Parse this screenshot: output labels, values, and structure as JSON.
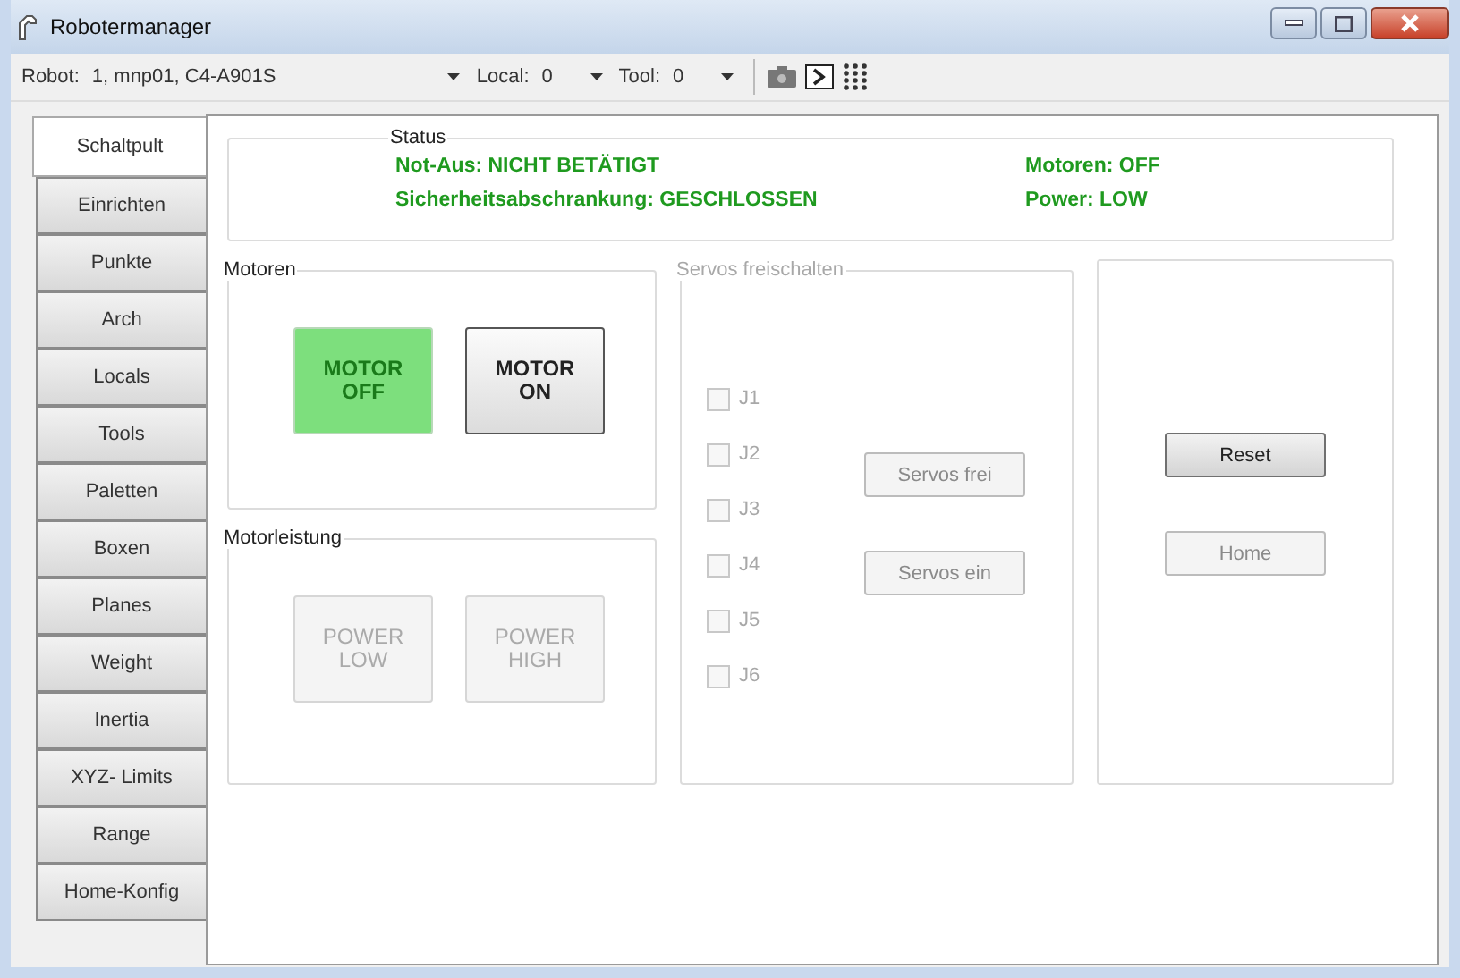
{
  "window": {
    "title": "Robotermanager"
  },
  "toolbar": {
    "fields": [
      {
        "label": "Robot:",
        "value": "1, mnp01, C4-A901S",
        "kind": "wide"
      },
      {
        "label": "Local:",
        "value": "0",
        "kind": "narrow"
      },
      {
        "label": "Tool:",
        "value": "0",
        "kind": "narrow"
      }
    ]
  },
  "tabs": [
    {
      "label": "Schaltpult",
      "selected": true
    },
    {
      "label": "Einrichten",
      "selected": false
    },
    {
      "label": "Punkte",
      "selected": false
    },
    {
      "label": "Arch",
      "selected": false
    },
    {
      "label": "Locals",
      "selected": false
    },
    {
      "label": "Tools",
      "selected": false
    },
    {
      "label": "Paletten",
      "selected": false
    },
    {
      "label": "Boxen",
      "selected": false
    },
    {
      "label": "Planes",
      "selected": false
    },
    {
      "label": "Weight",
      "selected": false
    },
    {
      "label": "Inertia",
      "selected": false
    },
    {
      "label": "XYZ- Limits",
      "selected": false
    },
    {
      "label": "Range",
      "selected": false
    },
    {
      "label": "Home-Konfig",
      "selected": false
    }
  ],
  "status": {
    "title": "Status",
    "items": [
      "Not-Aus: NICHT BETÄTIGT",
      "Motoren: OFF",
      "Sicherheitsabschrankung: GESCHLOSSEN",
      "Power: LOW"
    ]
  },
  "motoren": {
    "title": "Motoren",
    "buttons": [
      {
        "label": "MOTOR OFF",
        "active": true,
        "disabled": false
      },
      {
        "label": "MOTOR ON",
        "active": false,
        "disabled": false
      }
    ]
  },
  "motorleistung": {
    "title": "Motorleistung",
    "buttons": [
      {
        "label": "POWER LOW",
        "disabled": true
      },
      {
        "label": "POWER HIGH",
        "disabled": true
      }
    ]
  },
  "servos": {
    "title": "Servos freischalten",
    "disabled": true,
    "joints": [
      {
        "label": "J1",
        "checked": false
      },
      {
        "label": "J2",
        "checked": false
      },
      {
        "label": "J3",
        "checked": false
      },
      {
        "label": "J4",
        "checked": false
      },
      {
        "label": "J5",
        "checked": false
      },
      {
        "label": "J6",
        "checked": false
      }
    ],
    "buttons": [
      {
        "label": "Servos frei",
        "disabled": true
      },
      {
        "label": "Servos ein",
        "disabled": true
      }
    ]
  },
  "actions": {
    "buttons": [
      {
        "label": "Reset",
        "disabled": false
      },
      {
        "label": "Home",
        "disabled": true
      }
    ]
  }
}
